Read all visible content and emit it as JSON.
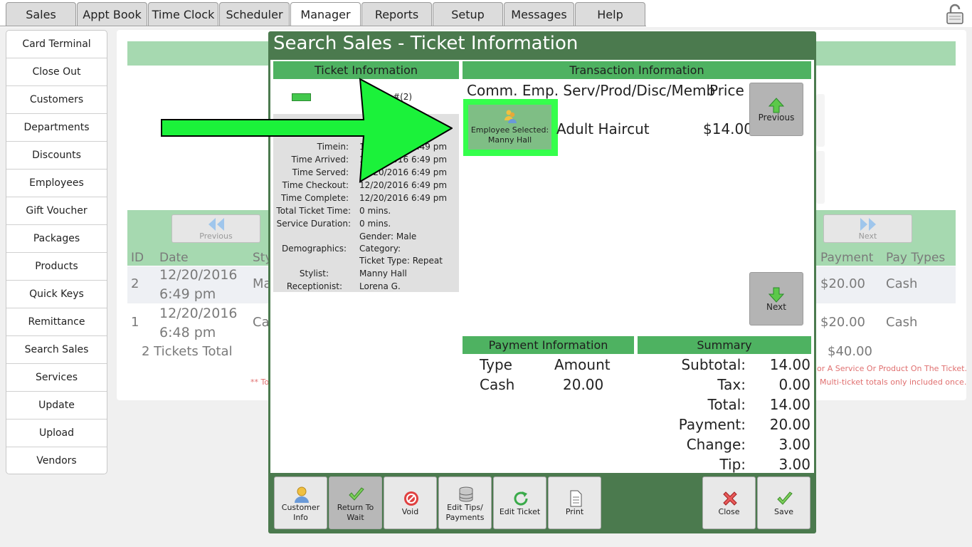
{
  "top_tabs": [
    "Sales",
    "Appt Book",
    "Time Clock",
    "Scheduler",
    "Manager",
    "Reports",
    "Setup",
    "Messages",
    "Help"
  ],
  "active_tab": "Manager",
  "left_menu": [
    "Card Terminal",
    "Close Out",
    "Customers",
    "Departments",
    "Discounts",
    "Employees",
    "Gift Voucher",
    "Packages",
    "Products",
    "Quick Keys",
    "Remittance",
    "Search Sales",
    "Services",
    "Update",
    "Upload",
    "Vendors"
  ],
  "background": {
    "prev_label": "Previous",
    "next_label": "Next",
    "columns": {
      "id": "ID",
      "date": "Date",
      "stylist_partial": "Sty",
      "payment": "Payment",
      "pay_types": "Pay Types"
    },
    "rows": [
      {
        "id": "2",
        "date1": "12/20/2016",
        "date2": "6:49 pm",
        "stylist_partial": "Ma",
        "payment": "$20.00",
        "pay_type": "Cash"
      },
      {
        "id": "1",
        "date1": "12/20/2016",
        "date2": "6:48 pm",
        "stylist_partial": "Ca",
        "payment": "$20.00",
        "pay_type": "Cash"
      }
    ],
    "total_label": "2 Tickets Total",
    "total_payment": "$40.00",
    "note1": "or A Service Or Product On The Ticket.",
    "note2": "Multi-ticket totals only included once.",
    "note_left": "** To"
  },
  "modal": {
    "title": "Search Sales - Ticket Information",
    "ticket_header": "Ticket Information",
    "ticket_number": "cket #(2)",
    "fields": [
      {
        "label": "Timein:",
        "value": "12/20/2016 6:49 pm"
      },
      {
        "label": "Time Arrived:",
        "value": "12/20/2016 6:49 pm"
      },
      {
        "label": "Time Served:",
        "value": "12/20/2016 6:49 pm"
      },
      {
        "label": "Time Checkout:",
        "value": "12/20/2016 6:49 pm"
      },
      {
        "label": "Time Complete:",
        "value": "12/20/2016 6:49 pm"
      },
      {
        "label": "Total Ticket Time:",
        "value": "0 mins."
      },
      {
        "label": "Service Duration:",
        "value": "0 mins."
      }
    ],
    "demographics_label": "Demographics:",
    "demographics": [
      "Gender: Male",
      "Category:",
      "Ticket Type: Repeat"
    ],
    "stylist_label": "Stylist:",
    "stylist": "Manny Hall",
    "receptionist_label": "Receptionist:",
    "receptionist": "Lorena G.",
    "transaction_header": "Transaction Information",
    "transaction_columns": "Comm. Emp. Serv/Prod/Disc/Memb",
    "price_column": "Price",
    "employee_selected_label": "Employee Selected:",
    "employee_selected_name": "Manny Hall",
    "service": "Adult Haircut",
    "service_price": "$14.00",
    "previous_label": "Previous",
    "next_label": "Next",
    "payment_header": "Payment Information",
    "payment_columns": {
      "type": "Type",
      "amount": "Amount"
    },
    "payments": [
      {
        "type": "Cash",
        "amount": "20.00"
      }
    ],
    "summary_header": "Summary",
    "summary": [
      {
        "label": "Subtotal:",
        "value": "14.00"
      },
      {
        "label": "Tax:",
        "value": "0.00"
      },
      {
        "label": "Total:",
        "value": "14.00"
      },
      {
        "label": "Payment:",
        "value": "20.00"
      },
      {
        "label": "Change:",
        "value": "3.00"
      },
      {
        "label": "Tip:",
        "value": "3.00"
      }
    ],
    "footer_buttons": [
      {
        "name": "customer-info",
        "line1": "Customer",
        "line2": "Info"
      },
      {
        "name": "return-to-wait",
        "line1": "Return To",
        "line2": "Wait"
      },
      {
        "name": "void",
        "line1": "Void",
        "line2": ""
      },
      {
        "name": "edit-tips-payments",
        "line1": "Edit Tips/",
        "line2": "Payments"
      },
      {
        "name": "edit-ticket",
        "line1": "Edit Ticket",
        "line2": ""
      },
      {
        "name": "print",
        "line1": "Print",
        "line2": ""
      },
      {
        "name": "close",
        "line1": "Close",
        "line2": ""
      },
      {
        "name": "save",
        "line1": "Save",
        "line2": ""
      }
    ]
  },
  "colors": {
    "modal_green": "#4b7a4e",
    "header_green": "#4eb261",
    "highlight": "#35ff4c",
    "arrow": "#1bf23a"
  }
}
